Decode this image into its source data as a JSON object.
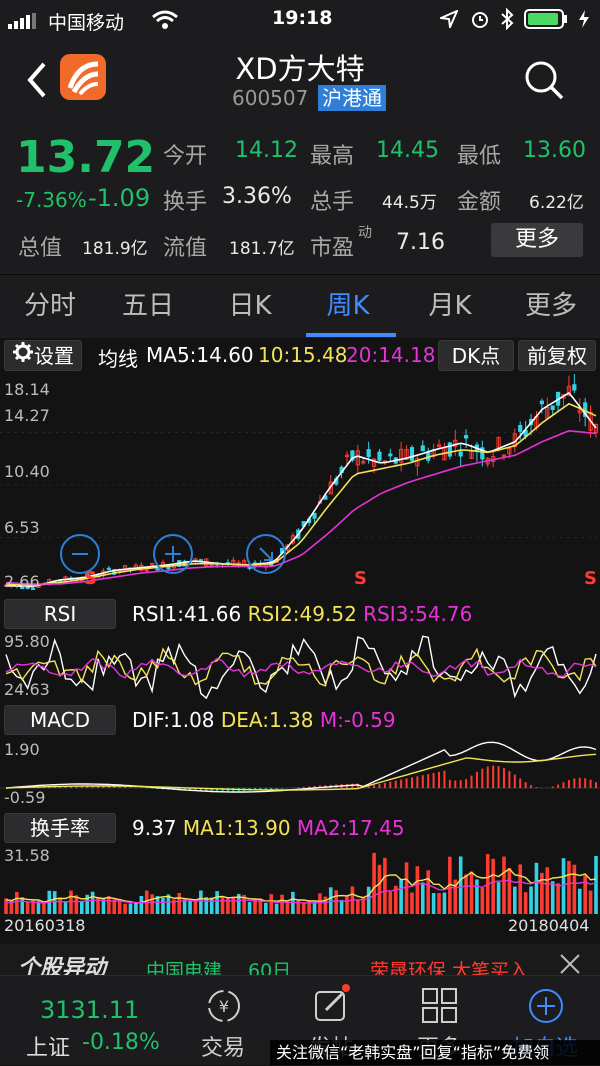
{
  "status_bar": {
    "carrier": "中国移动",
    "time": "19:18"
  },
  "header": {
    "title": "XD方大特",
    "code": "600507",
    "badge": "沪港通"
  },
  "quote": {
    "price": "13.72",
    "change_pct": "-7.36%",
    "change": "-1.09",
    "open_label": "今开",
    "open": "14.12",
    "high_label": "最高",
    "high": "14.45",
    "low_label": "最低",
    "low": "13.60",
    "turnover_label": "换手",
    "turnover": "3.36%",
    "volume_label": "总手",
    "volume": "44.5万",
    "amount_label": "金额",
    "amount": "6.22亿",
    "total_cap_label": "总值",
    "total_cap": "181.9亿",
    "float_cap_label": "流值",
    "float_cap": "181.7亿",
    "pe_label": "市盈",
    "pe_sup": "动",
    "pe": "7.16",
    "more_label": "更多"
  },
  "tabs": [
    {
      "label": "分时"
    },
    {
      "label": "五日"
    },
    {
      "label": "日K"
    },
    {
      "label": "周K"
    },
    {
      "label": "月K"
    },
    {
      "label": "更多"
    }
  ],
  "toolbar": {
    "settings": "设置",
    "ma_label": "均线",
    "ma5": "MA5:14.60",
    "ma10": "10:15.48",
    "ma20": "20:14.18",
    "dk": "DK点",
    "fq": "前复权"
  },
  "kline": {
    "y_labels": [
      "18.14",
      "14.27",
      "10.40",
      "6.53",
      "2.66"
    ],
    "signals": [
      "S",
      "S",
      "S"
    ]
  },
  "rsi": {
    "label": "RSI",
    "v1": "RSI1:41.66",
    "v2": "RSI2:49.52",
    "v3": "RSI3:54.76",
    "y_top": "95.80",
    "y_bottom": "24.63"
  },
  "macd": {
    "label": "MACD",
    "dif": "DIF:1.08",
    "dea": "DEA:1.38",
    "m": "M:-0.59",
    "y_top": "1.90",
    "y_bottom": "-0.59"
  },
  "turnover_rate": {
    "label": "换手率",
    "v": "9.37",
    "ma1": "MA1:13.90",
    "ma2": "MA2:17.45",
    "y_top": "31.58"
  },
  "dates": {
    "start": "20160318",
    "end": "20180404"
  },
  "ticker": {
    "title": "个股异动",
    "item1": "中国电建",
    "item2": "60日",
    "item3": "荣晟环保",
    "item4": "大笔买入"
  },
  "bottom_nav": {
    "index_value": "3131.11",
    "index_name": "上证",
    "index_change": "-0.18%",
    "trade": "交易",
    "publish": "发帖",
    "more": "更多",
    "add": "加自选"
  },
  "watermark": "关注微信“老韩实盘”回复“指标”免费领",
  "colors": {
    "up": "#ff3b30",
    "down": "#21c06b",
    "blue": "#3f8cff",
    "yellow": "#f2e35a",
    "magenta": "#e533d9",
    "white": "#ffffff",
    "cyan": "#33d1e6"
  },
  "chart_data": [
    {
      "type": "line",
      "title": "周K",
      "ylim": [
        2.66,
        18.14
      ],
      "series": [
        {
          "name": "MA5",
          "values": [
            3.0,
            2.9,
            3.4,
            3.6,
            4.1,
            4.3,
            4.5,
            4.8,
            4.6,
            4.5,
            4.7,
            7.0,
            10.0,
            12.6,
            12.0,
            12.4,
            13.0,
            13.5,
            12.8,
            13.6,
            16.0,
            17.2,
            14.6
          ]
        },
        {
          "name": "10",
          "values": [
            3.1,
            3.0,
            3.2,
            3.5,
            3.9,
            4.2,
            4.4,
            4.6,
            4.6,
            4.5,
            4.6,
            6.2,
            8.8,
            11.2,
            11.6,
            12.0,
            12.6,
            13.0,
            12.8,
            13.3,
            15.0,
            16.4,
            15.5
          ]
        },
        {
          "name": "20",
          "values": [
            3.2,
            3.1,
            3.1,
            3.3,
            3.6,
            3.9,
            4.1,
            4.3,
            4.4,
            4.4,
            4.4,
            5.2,
            6.8,
            8.6,
            9.8,
            10.6,
            11.2,
            11.8,
            12.2,
            12.6,
            13.6,
            14.4,
            14.2
          ]
        }
      ]
    }
  ]
}
